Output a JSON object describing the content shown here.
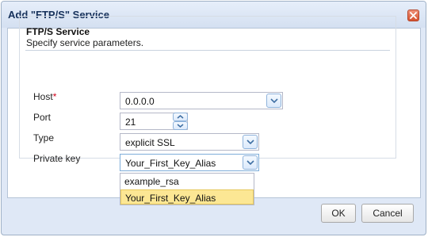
{
  "window": {
    "title": "Add \"FTP/S\" Service"
  },
  "section": {
    "title": "FTP/S Service",
    "subtitle": "Specify service parameters."
  },
  "form": {
    "host": {
      "label": "Host",
      "required_mark": "*",
      "value": "0.0.0.0"
    },
    "port": {
      "label": "Port",
      "value": "21"
    },
    "type": {
      "label": "Type",
      "value": "explicit SSL"
    },
    "private_key": {
      "label": "Private key",
      "value": "Your_First_Key_Alias"
    }
  },
  "private_key_options": [
    {
      "label": "example_rsa",
      "selected": false
    },
    {
      "label": "Your_First_Key_Alias",
      "selected": true
    }
  ],
  "buttons": {
    "ok": "OK",
    "cancel": "Cancel"
  },
  "colors": {
    "selected_option": "#fce794",
    "required": "#d0021b",
    "close_button": "#d5522f"
  },
  "icons": {
    "close": "close-icon",
    "dropdown": "chevron-down-icon",
    "spinner": [
      "chevron-up-icon",
      "chevron-down-icon"
    ]
  }
}
